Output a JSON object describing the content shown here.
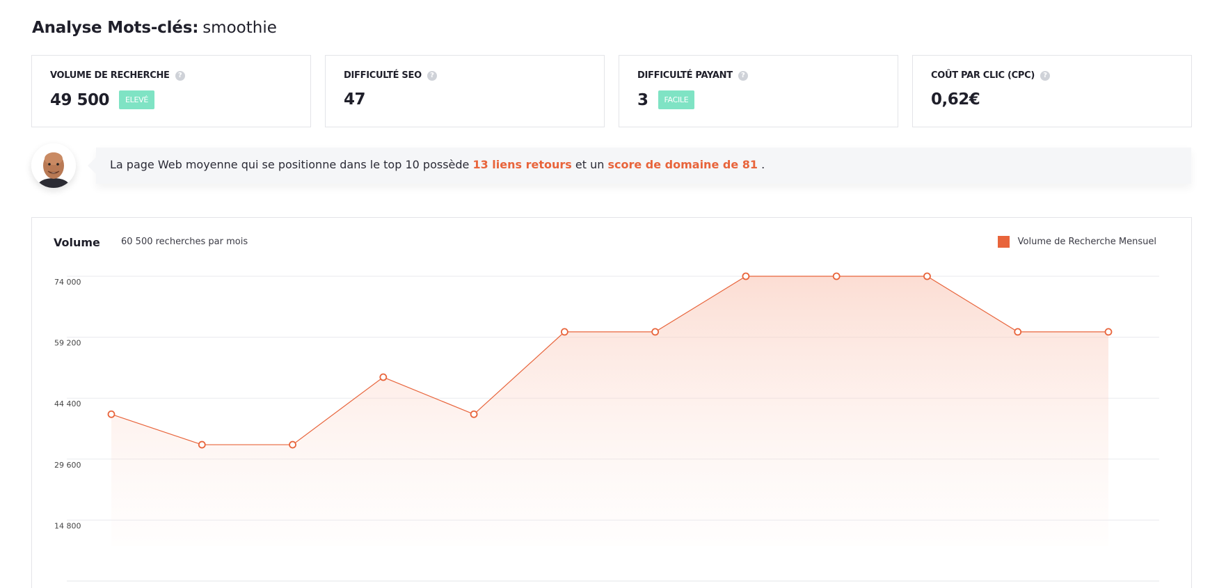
{
  "header": {
    "title_label": "Analyse Mots-clés:",
    "keyword": "smoothie"
  },
  "metrics": [
    {
      "label": "VOLUME DE RECHERCHE",
      "value": "49 500",
      "badge": "ELEVÉ"
    },
    {
      "label": "DIFFICULTÉ SEO",
      "value": "47",
      "badge": ""
    },
    {
      "label": "DIFFICULTÉ PAYANT",
      "value": "3",
      "badge": "FACILE"
    },
    {
      "label": "COÛT PAR CLIC (CPC)",
      "value": "0,62€",
      "badge": ""
    }
  ],
  "icons": {
    "help": "question-icon",
    "avatar": "avatar-photo"
  },
  "insight": {
    "prefix": "La page Web moyenne qui se positionne dans le top 10 possède",
    "backlinks": "13 liens retours",
    "middle": "et un",
    "domain_score": "score de domaine de 81",
    "suffix": "."
  },
  "colors": {
    "accent": "#e8643b",
    "badge": "#7fe3c4"
  },
  "chart_data": {
    "type": "area",
    "title": "Volume",
    "subtitle": "60 500 recherches par mois",
    "y_ticks": [
      "74 000",
      "59 200",
      "44 400",
      "29 600",
      "14 800"
    ],
    "y_tick_values": [
      74000,
      59200,
      44400,
      29600,
      14800
    ],
    "ylim": [
      0,
      74000
    ],
    "grid": true,
    "legend_position": "top-right",
    "series": [
      {
        "name": "Volume de Recherche Mensuel",
        "color": "#e8643b",
        "values": [
          40500,
          33100,
          33100,
          49500,
          40500,
          60500,
          60500,
          74000,
          74000,
          74000,
          60500,
          60500
        ]
      }
    ]
  }
}
